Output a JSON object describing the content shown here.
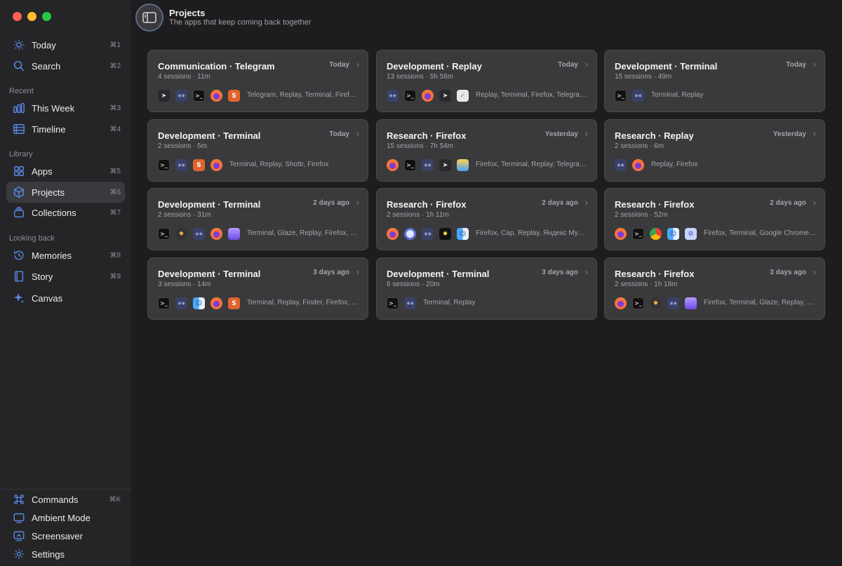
{
  "header": {
    "title": "Projects",
    "subtitle": "The apps that keep coming back together"
  },
  "sidebar": {
    "top": [
      {
        "label": "Today",
        "shortcut": "⌘1",
        "icon": "sun-icon"
      },
      {
        "label": "Search",
        "shortcut": "⌘2",
        "icon": "search-icon"
      }
    ],
    "sections": {
      "recent": "Recent",
      "library": "Library",
      "looking_back": "Looking back"
    },
    "recent": [
      {
        "label": "This Week",
        "shortcut": "⌘3",
        "icon": "bar-chart-icon"
      },
      {
        "label": "Timeline",
        "shortcut": "⌘4",
        "icon": "timeline-icon"
      }
    ],
    "library": [
      {
        "label": "Apps",
        "shortcut": "⌘5",
        "icon": "grid-icon"
      },
      {
        "label": "Projects",
        "shortcut": "⌘6",
        "icon": "cube-icon",
        "active": true
      },
      {
        "label": "Collections",
        "shortcut": "⌘7",
        "icon": "collections-icon"
      }
    ],
    "looking_back": [
      {
        "label": "Memories",
        "shortcut": "⌘8",
        "icon": "history-icon"
      },
      {
        "label": "Story",
        "shortcut": "⌘9",
        "icon": "book-icon"
      },
      {
        "label": "Canvas",
        "shortcut": "",
        "icon": "sparkle-icon"
      }
    ],
    "bottom": [
      {
        "label": "Commands",
        "shortcut": "⌘K",
        "icon": "command-icon"
      },
      {
        "label": "Ambient Mode",
        "shortcut": "",
        "icon": "ambient-icon"
      },
      {
        "label": "Screensaver",
        "shortcut": "",
        "icon": "screensaver-icon"
      },
      {
        "label": "Settings",
        "shortcut": "",
        "icon": "gear-icon"
      }
    ]
  },
  "cards": [
    {
      "title": "Communication · Telegram",
      "meta": "4 sessions · 11m",
      "time": "Today",
      "apps": "Telegram, Replay, Terminal, Firefox, Shottr",
      "icons": [
        "telegram",
        "replay",
        "terminal",
        "firefox",
        "shottr"
      ]
    },
    {
      "title": "Development · Replay",
      "meta": "13 sessions · 5h 56m",
      "time": "Today",
      "apps": "Replay, Terminal, Firefox, Telegram, AdGuard",
      "icons": [
        "replay",
        "terminal",
        "firefox",
        "telegram",
        "adguard"
      ]
    },
    {
      "title": "Development · Terminal",
      "meta": "15 sessions · 49m",
      "time": "Today",
      "apps": "Terminal, Replay",
      "icons": [
        "terminal",
        "replay"
      ]
    },
    {
      "title": "Development · Terminal",
      "meta": "2 sessions · 5m",
      "time": "Today",
      "apps": "Terminal, Replay, Shottr, Firefox",
      "icons": [
        "terminal",
        "replay",
        "shottr",
        "firefox"
      ]
    },
    {
      "title": "Research · Firefox",
      "meta": "15 sessions · 7h 54m",
      "time": "Yesterday",
      "apps": "Firefox, Terminal, Replay, Telegram, Weather",
      "icons": [
        "firefox",
        "terminal",
        "replay",
        "telegram",
        "yellowsq"
      ]
    },
    {
      "title": "Research · Replay",
      "meta": "2 sessions · 6m",
      "time": "Yesterday",
      "apps": "Replay, Firefox",
      "icons": [
        "replay",
        "firefox"
      ]
    },
    {
      "title": "Development · Terminal",
      "meta": "2 sessions · 31m",
      "time": "2 days ago",
      "apps": "Terminal, Glaze, Replay, Firefox, Stack",
      "icons": [
        "terminal",
        "glaze",
        "replay",
        "firefox",
        "stack"
      ]
    },
    {
      "title": "Research · Firefox",
      "meta": "2 sessions · 1h 11m",
      "time": "2 days ago",
      "apps": "Firefox, Cap, Replay, Яндекс Музыка, Finder",
      "icons": [
        "firefox",
        "cap",
        "replay",
        "yandex",
        "finder"
      ]
    },
    {
      "title": "Research · Firefox",
      "meta": "2 sessions · 52m",
      "time": "2 days ago",
      "apps": "Firefox, Terminal, Google Chrome, Finder",
      "icons": [
        "firefox",
        "terminal",
        "chrome",
        "finder",
        "blue"
      ]
    },
    {
      "title": "Development · Terminal",
      "meta": "3 sessions · 14m",
      "time": "3 days ago",
      "apps": "Terminal, Replay, Finder, Firefox, Shottr",
      "icons": [
        "terminal",
        "replay",
        "finder",
        "firefox",
        "shottr"
      ]
    },
    {
      "title": "Development · Terminal",
      "meta": "6 sessions · 20m",
      "time": "3 days ago",
      "apps": "Terminal, Replay",
      "icons": [
        "terminal",
        "replay"
      ]
    },
    {
      "title": "Research · Firefox",
      "meta": "2 sessions · 1h 18m",
      "time": "3 days ago",
      "apps": "Firefox, Terminal, Glaze, Replay, Stack",
      "icons": [
        "firefox",
        "terminal",
        "glaze",
        "replay",
        "stack"
      ]
    }
  ]
}
